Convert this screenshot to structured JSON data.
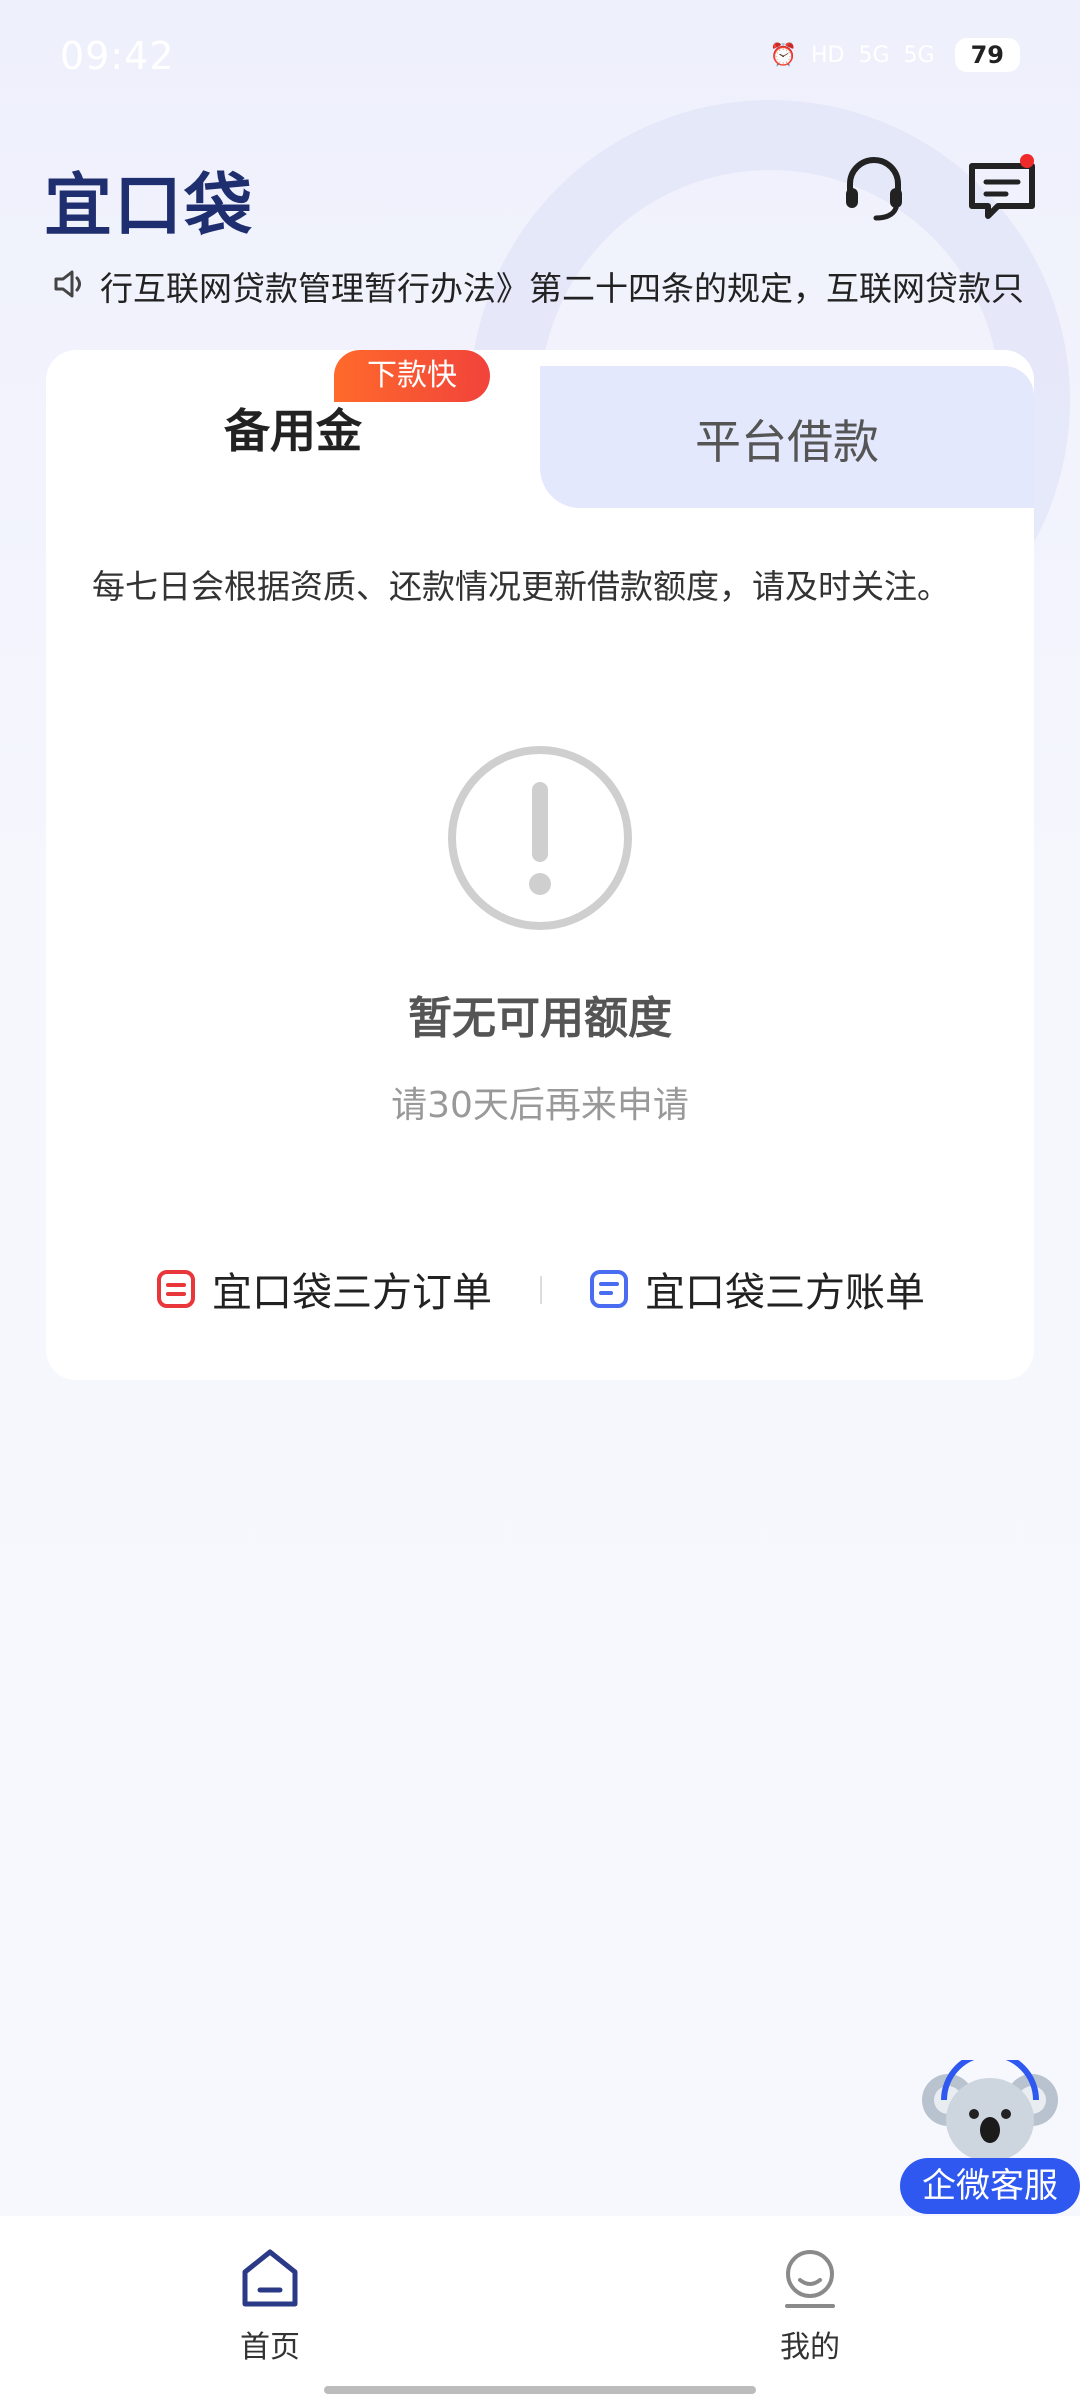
{
  "status_bar": {
    "time": "09:42",
    "hd": "HD",
    "net1": "5G",
    "net2": "5G",
    "battery": "79"
  },
  "header": {
    "logo": "宜口袋",
    "notice": "行互联网贷款管理暂行办法》第二十四条的规定，互联网贷款只"
  },
  "card": {
    "tabs": [
      {
        "label": "备用金",
        "badge": "下款快",
        "active": true
      },
      {
        "label": "平台借款",
        "active": false
      }
    ],
    "description": "每七日会根据资质、还款情况更新借款额度，请及时关注。",
    "empty_title": "暂无可用额度",
    "empty_subtitle": "请30天后再来申请",
    "links": [
      {
        "label": "宜口袋三方订单"
      },
      {
        "label": "宜口袋三方账单"
      }
    ]
  },
  "float_service": {
    "label": "企微客服"
  },
  "bottom_nav": [
    {
      "label": "首页",
      "active": true
    },
    {
      "label": "我的",
      "active": false
    }
  ],
  "colors": {
    "brand_navy": "#1f2e6e",
    "accent_blue": "#2f58f0",
    "badge_red": "#f1433b",
    "tab_inactive_bg": "#e3e8fd"
  }
}
